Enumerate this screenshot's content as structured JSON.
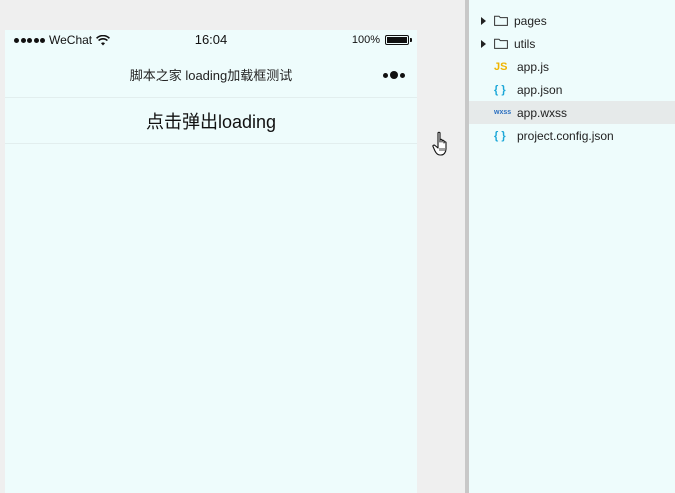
{
  "status_bar": {
    "carrier": "WeChat",
    "time": "16:04",
    "battery": "100%"
  },
  "nav": {
    "title": "脚本之家 loading加载框测试"
  },
  "main": {
    "button_label": "点击弹出loading"
  },
  "file_tree": {
    "items": [
      {
        "name": "pages",
        "type": "folder",
        "icon": "folder-icon"
      },
      {
        "name": "utils",
        "type": "folder",
        "icon": "folder-icon"
      },
      {
        "name": "app.js",
        "type": "file",
        "icon": "js-icon",
        "badge": "JS"
      },
      {
        "name": "app.json",
        "type": "file",
        "icon": "json-icon",
        "badge": "{ }"
      },
      {
        "name": "app.wxss",
        "type": "file",
        "icon": "wxss-icon",
        "badge": "wxss",
        "selected": true
      },
      {
        "name": "project.config.json",
        "type": "file",
        "icon": "json-icon",
        "badge": "{ }"
      }
    ]
  },
  "colors": {
    "page_bg": "#eefcfc",
    "workspace_bg": "#efefef",
    "splitter": "#c8c8c8",
    "js_badge": "#f0b400",
    "json_badge": "#1aa7d8",
    "selected_row": "#e6eaea"
  }
}
